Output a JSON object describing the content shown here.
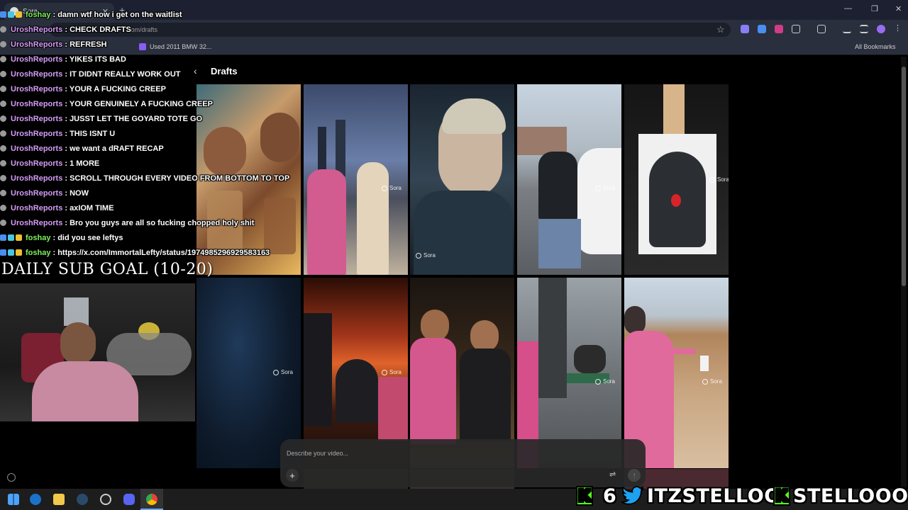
{
  "browser": {
    "tab_title": "Sora",
    "new_tab": "+",
    "url": "sora.chatgpt.com/drafts",
    "url_visible": "com/drafts",
    "bookmark_1": "Used 2011 BMW 32...",
    "all_bookmarks": "All Bookmarks",
    "window_controls": [
      "—",
      "❐",
      "✕"
    ]
  },
  "page": {
    "back_label": "‹",
    "title": "Drafts",
    "watermark": "Sora",
    "prompt_placeholder": "Describe your video...",
    "plus": "+",
    "send": "↑",
    "settings": "⇌"
  },
  "chat": {
    "messages": [
      {
        "user": "foshay",
        "text": ": damn wtf how i get on the waitlist",
        "kind": "f"
      },
      {
        "user": "UroshReports",
        "text": ": CHECK DRAFTS",
        "kind": "u"
      },
      {
        "user": "UroshReports",
        "text": ": REFRESH",
        "kind": "u"
      },
      {
        "user": "UroshReports",
        "text": ": YIKES ITS BAD",
        "kind": "u"
      },
      {
        "user": "UroshReports",
        "text": ": IT DIDNT REALLY WORK OUT",
        "kind": "u"
      },
      {
        "user": "UroshReports",
        "text": ": YOUR A FUCKING CREEP",
        "kind": "u"
      },
      {
        "user": "UroshReports",
        "text": ": YOUR GENUINELY A FUCKING CREEP",
        "kind": "u"
      },
      {
        "user": "UroshReports",
        "text": ": JUSST LET THE GOYARD TOTE GO",
        "kind": "u"
      },
      {
        "user": "UroshReports",
        "text": ": THIS ISNT U",
        "kind": "u"
      },
      {
        "user": "UroshReports",
        "text": ": we want a dRAFT RECAP",
        "kind": "u"
      },
      {
        "user": "UroshReports",
        "text": ": 1 MORE",
        "kind": "u"
      },
      {
        "user": "UroshReports",
        "text": ": SCROLL THROUGH EVERY VIDEO FROM BOTTOM TO TOP",
        "kind": "u"
      },
      {
        "user": "UroshReports",
        "text": ": NOW",
        "kind": "u"
      },
      {
        "user": "UroshReports",
        "text": ": axIOM TIME",
        "kind": "u"
      },
      {
        "user": "UroshReports",
        "text": ": Bro you guys are all so fucking chopped holy shit",
        "kind": "u"
      },
      {
        "user": "foshay",
        "text": ": did you see leftys",
        "kind": "f"
      },
      {
        "user": "foshay",
        "text": ": https://x.com/ImmortalLefty/status/1974985296929583163",
        "kind": "f"
      }
    ]
  },
  "overlay": {
    "sub_goal": "DAILY SUB GOAL (10-20)",
    "kick_count": "6",
    "twitter_handle": "ITZSTELLOO",
    "kick_handle": "STELLOOO",
    "kick_letter": "K"
  },
  "colors": {
    "chat_user_foshay": "#7ef05c",
    "chat_user_urosh": "#d59cf7",
    "kick_green": "#53fc18",
    "twitter_blue": "#1da1f2"
  }
}
